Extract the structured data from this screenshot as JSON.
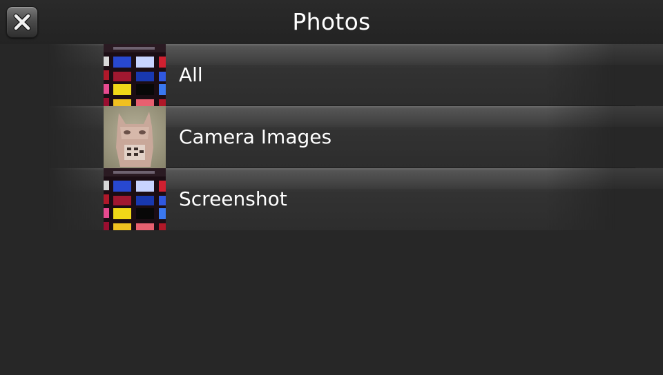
{
  "header": {
    "title": "Photos",
    "close_icon": "close-icon"
  },
  "albums": [
    {
      "label": "All",
      "thumbnail": "color-swatch-thumbnail"
    },
    {
      "label": "Camera Images",
      "thumbnail": "photo-thumbnail"
    },
    {
      "label": "Screenshot",
      "thumbnail": "color-swatch-thumbnail"
    }
  ],
  "colors": {
    "background": "#272727",
    "text": "#ffffff"
  }
}
